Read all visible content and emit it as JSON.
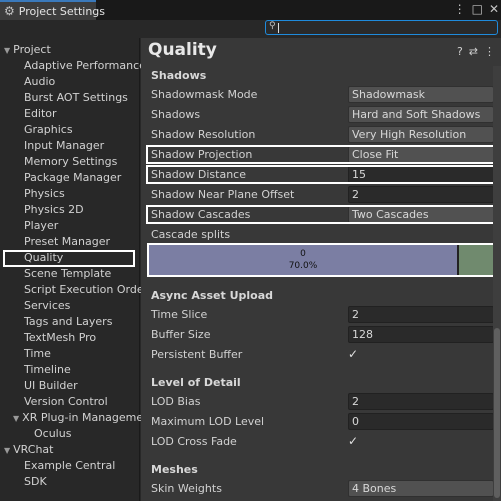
{
  "window": {
    "tab_label": "Project Settings",
    "controls": [
      "⋮",
      "□",
      "✕"
    ]
  },
  "search": {
    "placeholder": "",
    "value": ""
  },
  "sidebar": {
    "items": [
      {
        "label": "Project",
        "indent": 0,
        "arrow": "▼"
      },
      {
        "label": "Adaptive Performance",
        "indent": 1
      },
      {
        "label": "Audio",
        "indent": 1
      },
      {
        "label": "Burst AOT Settings",
        "indent": 1
      },
      {
        "label": "Editor",
        "indent": 1
      },
      {
        "label": "Graphics",
        "indent": 1
      },
      {
        "label": "Input Manager",
        "indent": 1
      },
      {
        "label": "Memory Settings",
        "indent": 1
      },
      {
        "label": "Package Manager",
        "indent": 1
      },
      {
        "label": "Physics",
        "indent": 1
      },
      {
        "label": "Physics 2D",
        "indent": 1
      },
      {
        "label": "Player",
        "indent": 1
      },
      {
        "label": "Preset Manager",
        "indent": 1
      },
      {
        "label": "Quality",
        "indent": 1,
        "selected": true
      },
      {
        "label": "Scene Template",
        "indent": 1
      },
      {
        "label": "Script Execution Order",
        "indent": 1
      },
      {
        "label": "Services",
        "indent": 1
      },
      {
        "label": "Tags and Layers",
        "indent": 1
      },
      {
        "label": "TextMesh Pro",
        "indent": 1
      },
      {
        "label": "Time",
        "indent": 1
      },
      {
        "label": "Timeline",
        "indent": 1
      },
      {
        "label": "UI Builder",
        "indent": 1
      },
      {
        "label": "Version Control",
        "indent": 1
      },
      {
        "label": "XR Plug-in Management",
        "indent": 1,
        "arrow": "▼"
      },
      {
        "label": "Oculus",
        "indent": 2
      },
      {
        "label": "VRChat",
        "indent": 0,
        "arrow": "▼"
      },
      {
        "label": "Example Central",
        "indent": 1
      },
      {
        "label": "SDK",
        "indent": 1
      }
    ]
  },
  "main": {
    "title": "Quality",
    "header_icons": [
      "?",
      "⇄",
      "⋮"
    ],
    "shadows": {
      "heading": "Shadows",
      "rows": [
        {
          "label": "Shadowmask Mode",
          "value": "Shadowmask",
          "kind": "dropdown"
        },
        {
          "label": "Shadows",
          "value": "Hard and Soft Shadows",
          "kind": "dropdown"
        },
        {
          "label": "Shadow Resolution",
          "value": "Very High Resolution",
          "kind": "dropdown"
        },
        {
          "label": "Shadow Projection",
          "value": "Close Fit",
          "kind": "dropdown",
          "highlight": true
        },
        {
          "label": "Shadow Distance",
          "value": "15",
          "kind": "text",
          "highlight": true
        },
        {
          "label": "Shadow Near Plane Offset",
          "value": "2",
          "kind": "text"
        },
        {
          "label": "Shadow Cascades",
          "value": "Two Cascades",
          "kind": "dropdown",
          "highlight": true
        }
      ],
      "cascade_label": "Cascade splits",
      "cascade": {
        "index": "0",
        "percent": "70.0%",
        "fraction": 0.7
      }
    },
    "async": {
      "heading": "Async Asset Upload",
      "rows": [
        {
          "label": "Time Slice",
          "value": "2",
          "kind": "text"
        },
        {
          "label": "Buffer Size",
          "value": "128",
          "kind": "text"
        },
        {
          "label": "Persistent Buffer",
          "value": "✓",
          "kind": "check"
        }
      ]
    },
    "lod": {
      "heading": "Level of Detail",
      "rows": [
        {
          "label": "LOD Bias",
          "value": "2",
          "kind": "text"
        },
        {
          "label": "Maximum LOD Level",
          "value": "0",
          "kind": "text"
        },
        {
          "label": "LOD Cross Fade",
          "value": "✓",
          "kind": "check"
        }
      ]
    },
    "meshes": {
      "heading": "Meshes",
      "rows": [
        {
          "label": "Skin Weights",
          "value": "4 Bones",
          "kind": "dropdown"
        }
      ]
    }
  }
}
